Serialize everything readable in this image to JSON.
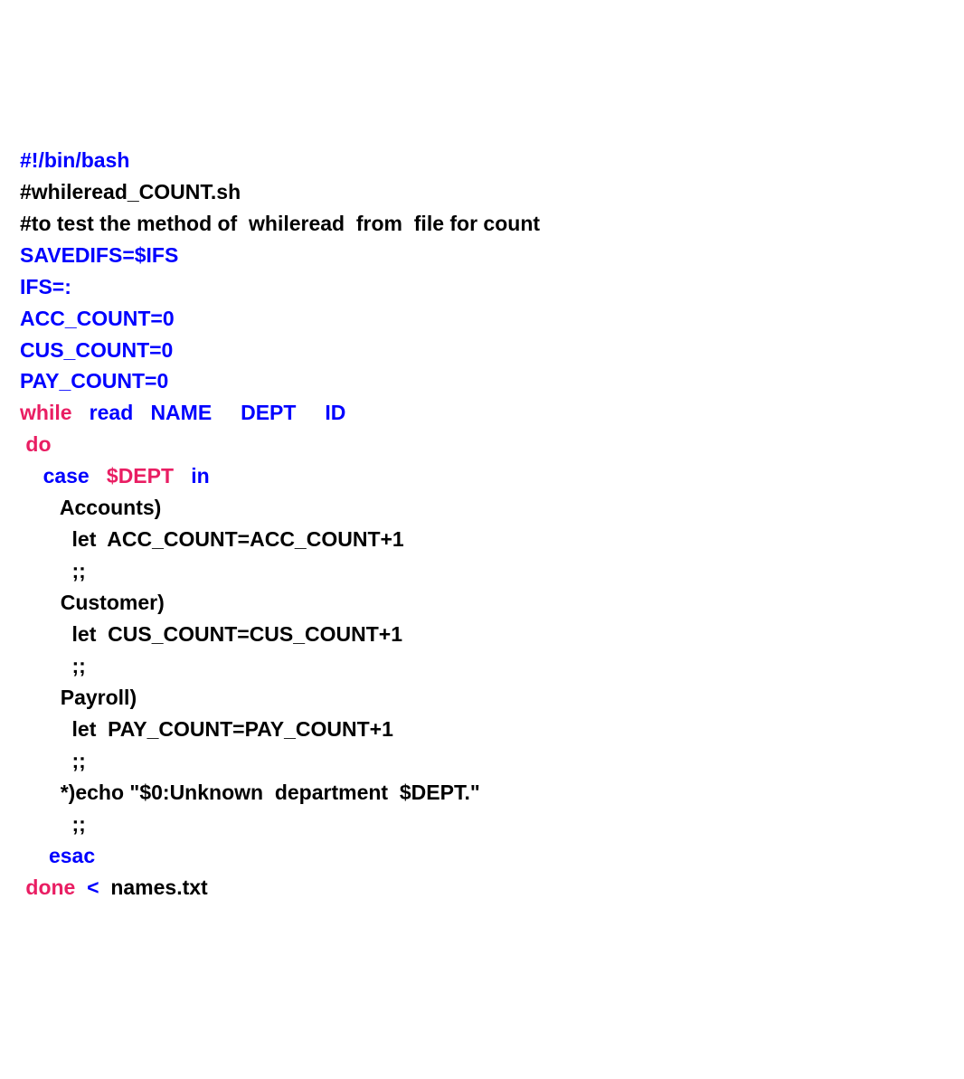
{
  "lines": [
    {
      "indent": 0,
      "segments": [
        {
          "color": "blue",
          "text": "#!/bin/bash"
        }
      ]
    },
    {
      "indent": 0,
      "segments": [
        {
          "color": "black",
          "text": "#whileread_COUNT.sh"
        }
      ]
    },
    {
      "indent": 0,
      "segments": [
        {
          "color": "black",
          "text": "#to test the method of  whileread  from  file for count"
        }
      ]
    },
    {
      "indent": 0,
      "segments": [
        {
          "color": "blue",
          "text": "SAVEDIFS=$IFS"
        }
      ]
    },
    {
      "indent": 0,
      "segments": [
        {
          "color": "blue",
          "text": "IFS=:"
        }
      ]
    },
    {
      "indent": 0,
      "segments": [
        {
          "color": "blue",
          "text": "ACC_COUNT=0"
        }
      ]
    },
    {
      "indent": 0,
      "segments": [
        {
          "color": "blue",
          "text": "CUS_COUNT=0"
        }
      ]
    },
    {
      "indent": 0,
      "segments": [
        {
          "color": "blue",
          "text": "PAY_COUNT=0"
        }
      ]
    },
    {
      "indent": 0,
      "segments": [
        {
          "color": "pink",
          "text": "while"
        },
        {
          "color": "blue",
          "text": "   read   NAME     DEPT     ID"
        }
      ]
    },
    {
      "indent": 1,
      "segments": [
        {
          "color": "pink",
          "text": "do"
        }
      ]
    },
    {
      "indent": 4,
      "segments": [
        {
          "color": "blue",
          "text": "case"
        },
        {
          "color": "pink",
          "text": "   $DEPT"
        },
        {
          "color": "blue",
          "text": "   in"
        }
      ]
    },
    {
      "indent": 7,
      "segments": [
        {
          "color": "black",
          "text": "Accounts)"
        }
      ]
    },
    {
      "indent": 9,
      "segments": [
        {
          "color": "black",
          "text": "let  ACC_COUNT=ACC_COUNT+1"
        }
      ]
    },
    {
      "indent": 9,
      "segments": [
        {
          "color": "black",
          "text": ";;"
        }
      ]
    },
    {
      "indent": 7,
      "segments": [
        {
          "color": "black",
          "text": "Customer)"
        }
      ]
    },
    {
      "indent": 9,
      "segments": [
        {
          "color": "black",
          "text": "let  CUS_COUNT=CUS_COUNT+1"
        }
      ]
    },
    {
      "indent": 9,
      "segments": [
        {
          "color": "black",
          "text": ";;"
        }
      ]
    },
    {
      "indent": 7,
      "segments": [
        {
          "color": "black",
          "text": "Payroll)"
        }
      ]
    },
    {
      "indent": 9,
      "segments": [
        {
          "color": "black",
          "text": "let  PAY_COUNT=PAY_COUNT+1"
        }
      ]
    },
    {
      "indent": 9,
      "segments": [
        {
          "color": "black",
          "text": ";;"
        }
      ]
    },
    {
      "indent": 7,
      "segments": [
        {
          "color": "black",
          "text": "*)echo \"$0:Unknown  department  $DEPT.\""
        }
      ]
    },
    {
      "indent": 9,
      "segments": [
        {
          "color": "black",
          "text": ";;"
        }
      ]
    },
    {
      "indent": 5,
      "segments": [
        {
          "color": "blue",
          "text": "esac"
        }
      ]
    },
    {
      "indent": 1,
      "segments": [
        {
          "color": "pink",
          "text": "done"
        },
        {
          "color": "blue",
          "text": "  <"
        },
        {
          "color": "black",
          "text": "  names.txt"
        }
      ]
    }
  ]
}
